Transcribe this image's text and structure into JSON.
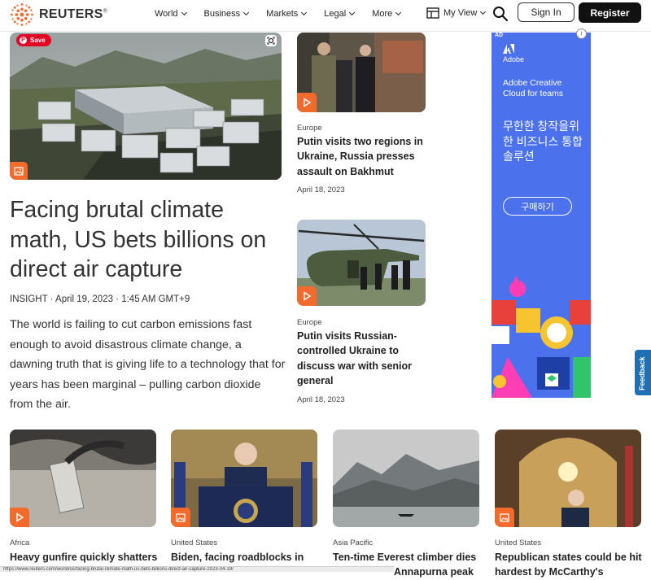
{
  "brand": {
    "name": "REUTERS",
    "mark": "®"
  },
  "nav": [
    {
      "label": "World"
    },
    {
      "label": "Business"
    },
    {
      "label": "Markets"
    },
    {
      "label": "Legal"
    },
    {
      "label": "More"
    }
  ],
  "header": {
    "my_view": "My View",
    "sign_in": "Sign In",
    "register": "Register"
  },
  "pin_save": "Save",
  "hero": {
    "title": "Facing brutal climate math, US bets billions on direct air capture",
    "meta": "INSIGHT · April 19, 2023 · 1:45 AM GMT+9",
    "description": "The world is failing to cut carbon emissions fast enough to avoid disastrous climate change, a dawning truth that is giving life to a technology that for years has been marginal – pulling carbon dioxide from the air."
  },
  "side_stories": [
    {
      "kicker": "Europe",
      "title": "Putin visits two regions in Ukraine, Russia presses assault on Bakhmut",
      "date": "April 18, 2023",
      "media": "video"
    },
    {
      "kicker": "Europe",
      "title": "Putin visits Russian-controlled Ukraine to discuss war with senior general",
      "date": "April 18, 2023",
      "media": "video"
    }
  ],
  "ad": {
    "choice": "AD",
    "brand": "Adobe",
    "headline": "Adobe Creative Cloud for teams",
    "korean": "무한한 창작을위한 비즈니스 통합 솔루션",
    "cta": "구매하기"
  },
  "feedback": "Feedback",
  "cards": [
    {
      "kicker": "Africa",
      "title": "Heavy gunfire quickly shatters",
      "media": "video"
    },
    {
      "kicker": "United States",
      "title": "Biden, facing roadblocks in",
      "media": "image"
    },
    {
      "kicker": "Asia Pacific",
      "title": "Ten-time Everest climber dies",
      "subtitle_fragment": "Annapurna peak",
      "media": "none"
    },
    {
      "kicker": "United States",
      "title": "Republican states could be hit hardest by McCarthy's",
      "media": "image"
    }
  ],
  "status_bar": "https://www.reuters.com/world/us/facing-brutal-climate-math-us-bets-billions-direct-air-capture-2023-04-19/",
  "colors": {
    "accent": "#f26b2c",
    "ad_bg": "#4b71ec",
    "pinterest": "#e60023",
    "feedback": "#1f6fb5"
  }
}
